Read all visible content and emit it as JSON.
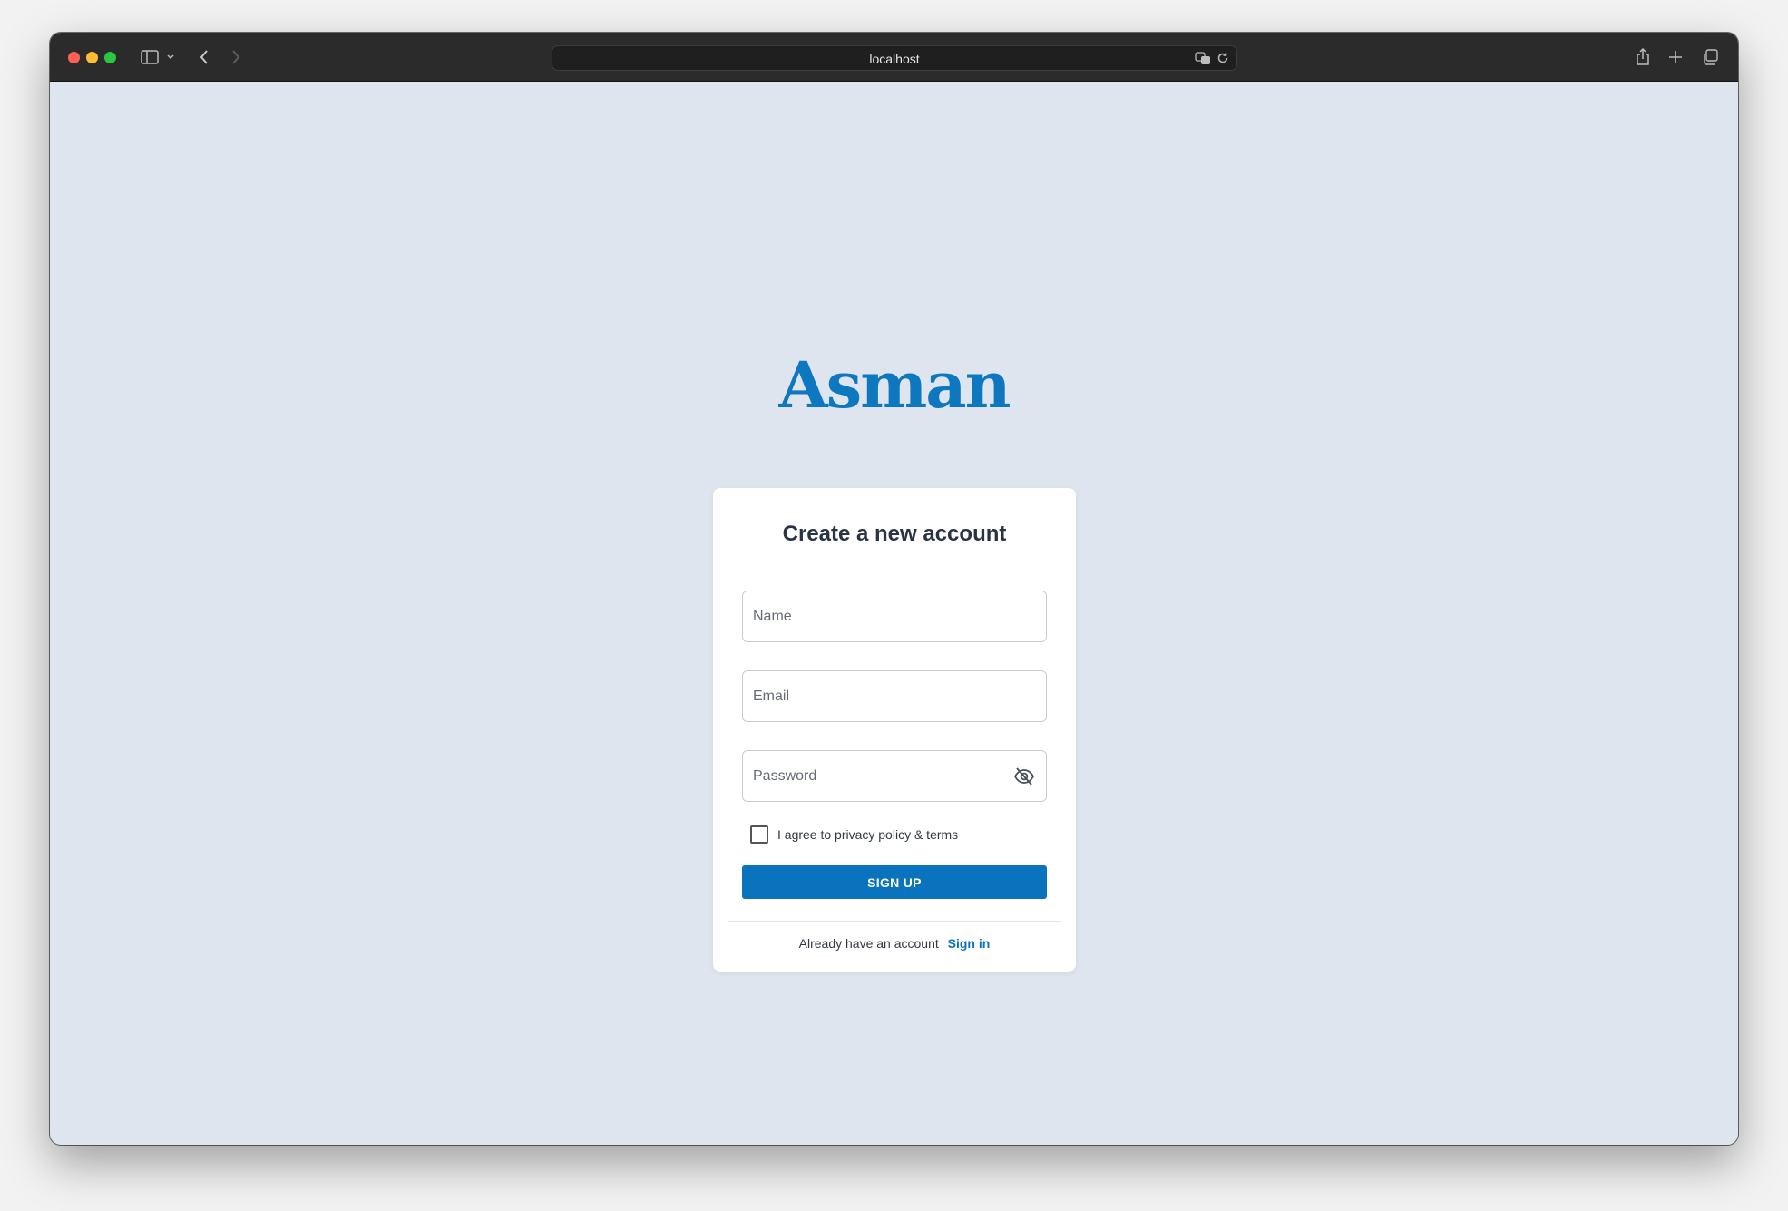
{
  "browser": {
    "url": "localhost",
    "icons": {
      "sidebar_toggle": "sidebar-icon",
      "back": "chevron-left-icon",
      "forward": "chevron-right-icon",
      "translate": "translate-icon",
      "reload": "reload-icon",
      "share": "share-icon",
      "new_tab": "plus-icon",
      "tab_overview": "tabs-icon"
    }
  },
  "page": {
    "logo": "Asman",
    "card": {
      "title": "Create a new account",
      "name_placeholder": "Name",
      "email_placeholder": "Email",
      "password_placeholder": "Password",
      "agree_label": "I agree to privacy policy & terms",
      "agree_checked": false,
      "signup_label": "SIGN UP",
      "signin_prompt": "Already have an account",
      "signin_link": "Sign in"
    }
  },
  "colors": {
    "brand": "#0d77c0",
    "button": "#0a73be",
    "page_background": "#dfe5ee",
    "title_text": "#2a3344"
  }
}
